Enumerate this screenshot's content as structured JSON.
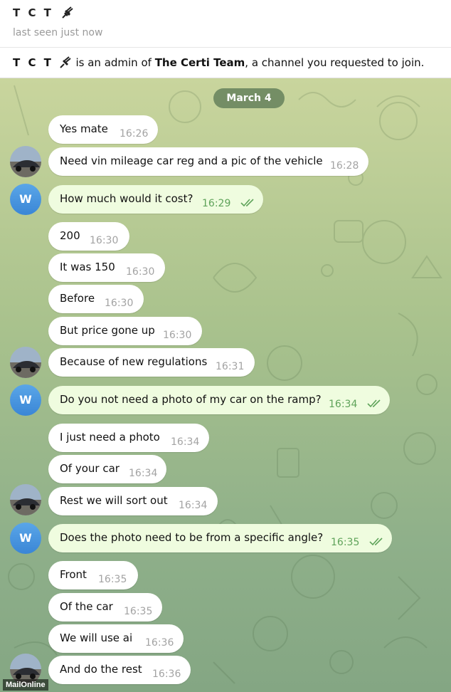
{
  "header": {
    "contact_name": "T C T",
    "status": "last seen just now"
  },
  "notice": {
    "contact_name": "T C T",
    "text_admin": " is an admin of ",
    "channel_name": "The Certi Team",
    "text_tail": ", a channel you requested to join."
  },
  "chat": {
    "date_label": "March 4",
    "avatar_letter": "W",
    "messages": [
      {
        "text": "Yes mate",
        "time": "16:26",
        "direction": "in"
      },
      {
        "text": "Need vin mileage car reg and a pic of the vehicle",
        "time": "16:28",
        "direction": "in"
      },
      {
        "text": "How much would it cost?",
        "time": "16:29",
        "direction": "out",
        "status": "read"
      },
      {
        "text": "200",
        "time": "16:30",
        "direction": "in"
      },
      {
        "text": "It was 150",
        "time": "16:30",
        "direction": "in"
      },
      {
        "text": "Before",
        "time": "16:30",
        "direction": "in"
      },
      {
        "text": "But price gone up",
        "time": "16:30",
        "direction": "in"
      },
      {
        "text": "Because of new regulations",
        "time": "16:31",
        "direction": "in"
      },
      {
        "text": "Do you not need a photo of my car on the ramp?",
        "time": "16:34",
        "direction": "out",
        "status": "read"
      },
      {
        "text": "I just need a photo",
        "time": "16:34",
        "direction": "in"
      },
      {
        "text": "Of your car",
        "time": "16:34",
        "direction": "in"
      },
      {
        "text": "Rest we will sort out",
        "time": "16:34",
        "direction": "in"
      },
      {
        "text": "Does the photo need to be from a specific angle?",
        "time": "16:35",
        "direction": "out",
        "status": "read"
      },
      {
        "text": "Front",
        "time": "16:35",
        "direction": "in"
      },
      {
        "text": "Of the car",
        "time": "16:35",
        "direction": "in"
      },
      {
        "text": "We will use ai",
        "time": "16:36",
        "direction": "in"
      },
      {
        "text": "And do the rest",
        "time": "16:36",
        "direction": "in"
      }
    ]
  },
  "watermark": "MailOnline",
  "colors": {
    "incoming_bubble": "#ffffff",
    "outgoing_bubble": "#effcdf",
    "outgoing_time": "#5fa35a",
    "date_pill": "#5c7a56",
    "avatar_w": "#3a86d6"
  }
}
